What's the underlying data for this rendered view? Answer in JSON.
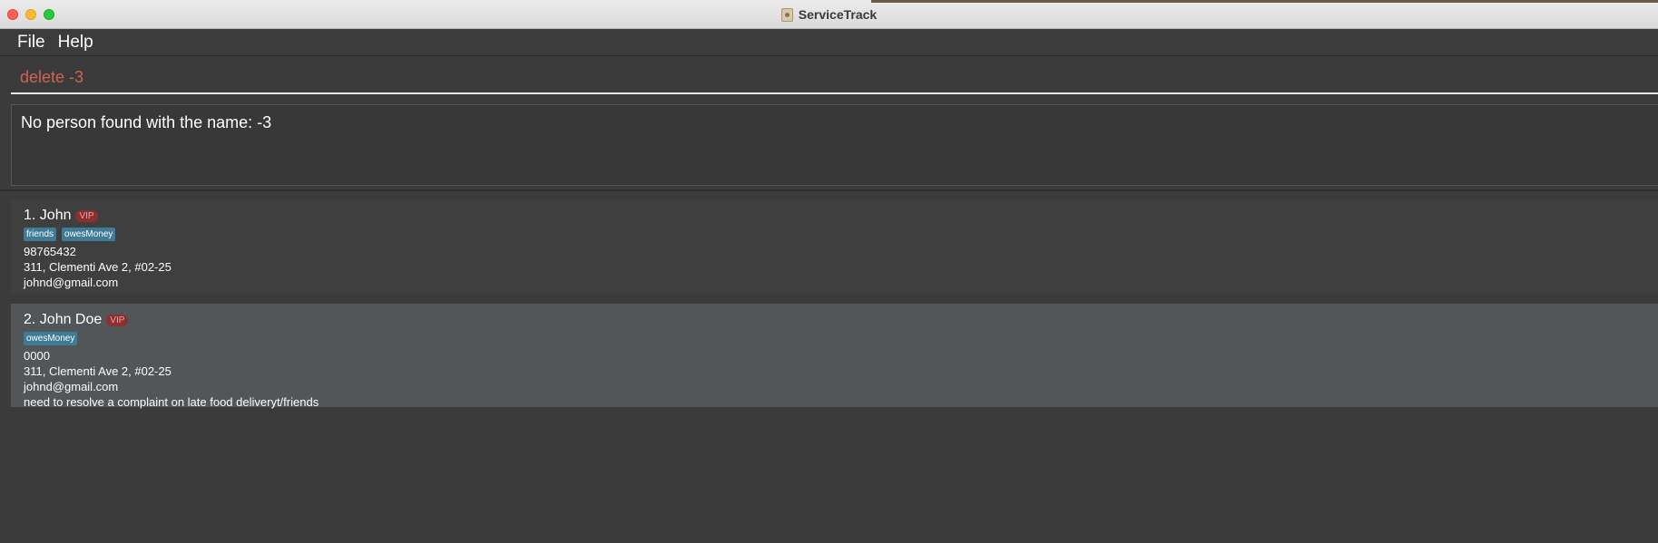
{
  "window": {
    "title": "ServiceTrack"
  },
  "menu": {
    "file": "File",
    "help": "Help"
  },
  "command": {
    "value": "delete -3"
  },
  "result": {
    "message": "No person found with the name: -3"
  },
  "persons": [
    {
      "name": "1. John",
      "badge": "VIP",
      "tags": [
        "friends",
        "owesMoney"
      ],
      "phone": "98765432",
      "address": "311, Clementi Ave 2, #02-25",
      "email": "johnd@gmail.com"
    },
    {
      "name": "2. John Doe",
      "badge": "VIP",
      "tags": [
        "owesMoney"
      ],
      "phone": "0000",
      "address": "311, Clementi Ave 2, #02-25",
      "email": "johnd@gmail.com",
      "remark": "need to resolve a complaint on late food deliveryt/friends"
    }
  ],
  "colors": {
    "command_text": "#d0634f",
    "tag_bg": "#3d7b96",
    "vip_bg": "#8b2f2f",
    "selected_card": "#525659"
  }
}
